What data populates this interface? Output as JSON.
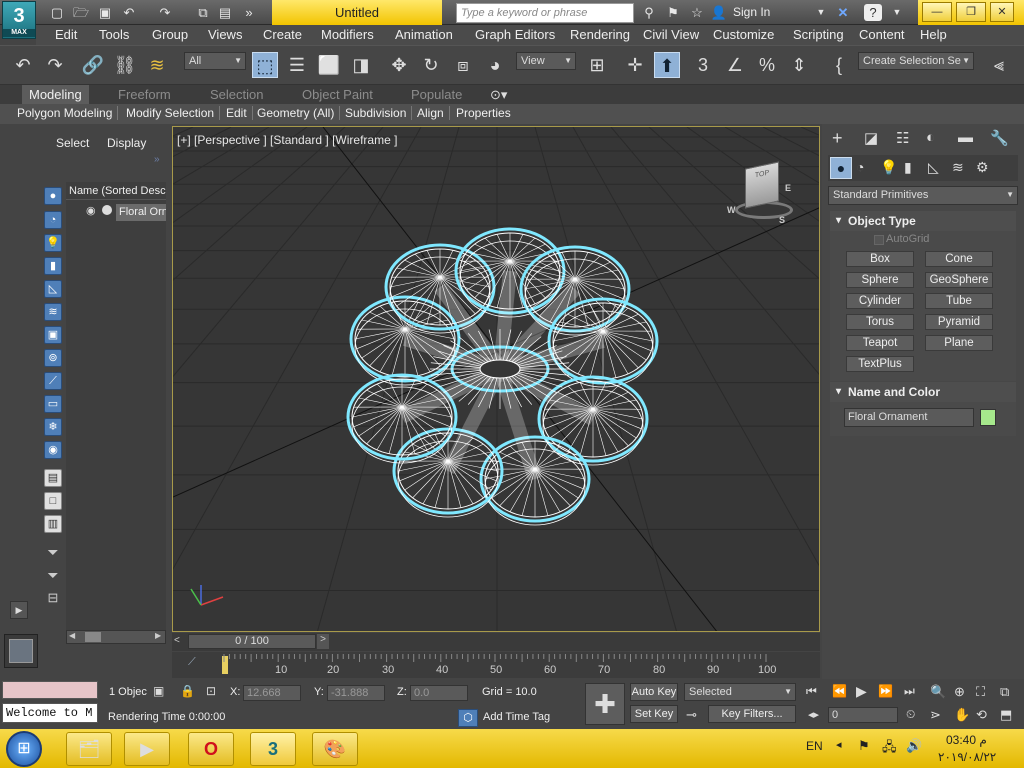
{
  "app": {
    "logo_number": "3",
    "logo_text": "MAX",
    "doc_title": "Untitled",
    "search_placeholder": "Type a keyword or phrase",
    "sign_in": "Sign In",
    "help_glyph": "?"
  },
  "menu": [
    "Edit",
    "Tools",
    "Group",
    "Views",
    "Create",
    "Modifiers",
    "Animation",
    "Graph Editors",
    "Rendering",
    "Civil View",
    "Customize",
    "Scripting",
    "Content",
    "Help"
  ],
  "toolbar": {
    "filter_value": "All",
    "refcoord_value": "View",
    "named_sel_value": "Create Selection Se"
  },
  "ribbon": {
    "tabs": [
      "Modeling",
      "Freeform",
      "Selection",
      "Object Paint",
      "Populate"
    ],
    "subtabs": [
      "Polygon Modeling",
      "Modify Selection",
      "Edit",
      "Geometry (All)",
      "Subdivision",
      "Align",
      "Properties"
    ]
  },
  "explorer": {
    "tab_select": "Select",
    "tab_display": "Display",
    "column_header": "Name (Sorted Desce",
    "items": [
      "Floral Orn"
    ]
  },
  "viewport": {
    "label": "[+] [Perspective ] [Standard ] [Wireframe ]",
    "viewcube_face": "TOP",
    "compass": {
      "w": "W",
      "s": "S",
      "e": "E"
    }
  },
  "timeslider": {
    "value": "0 / 100",
    "ticks": [
      "0",
      "10",
      "20",
      "30",
      "40",
      "50",
      "60",
      "70",
      "80",
      "90",
      "100"
    ]
  },
  "cmdpanel": {
    "dropdown": "Standard Primitives",
    "object_type_title": "Object Type",
    "autogrid": "AutoGrid",
    "buttons": [
      "Box",
      "Cone",
      "Sphere",
      "GeoSphere",
      "Cylinder",
      "Tube",
      "Torus",
      "Pyramid",
      "Teapot",
      "Plane",
      "TextPlus"
    ],
    "name_color_title": "Name and Color",
    "object_name": "Floral Ornament",
    "object_color": "#a6e88c"
  },
  "status": {
    "maxscript_text": "Welcome to M",
    "selection_count": "1 Objec",
    "x_label": "X:",
    "x_value": "12.668",
    "y_label": "Y:",
    "y_value": "-31.888",
    "z_label": "Z:",
    "z_value": "0.0",
    "grid": "Grid = 10.0",
    "rendering_time": "Rendering Time  0:00:00",
    "add_time_tag": "Add Time Tag",
    "auto_key": "Auto Key",
    "set_key": "Set Key",
    "selected": "Selected",
    "key_filters": "Key Filters...",
    "frame_value": "0"
  },
  "taskbar": {
    "lang": "EN",
    "time": "03:40 م",
    "date": "٢٠١٩/٠٨/٢٢"
  },
  "colors": {
    "selection_cyan": "#7fe8ff",
    "wire_white": "#ffffff",
    "viewport_bg": "#363636",
    "taskbar_yellow": "#f2c400"
  }
}
